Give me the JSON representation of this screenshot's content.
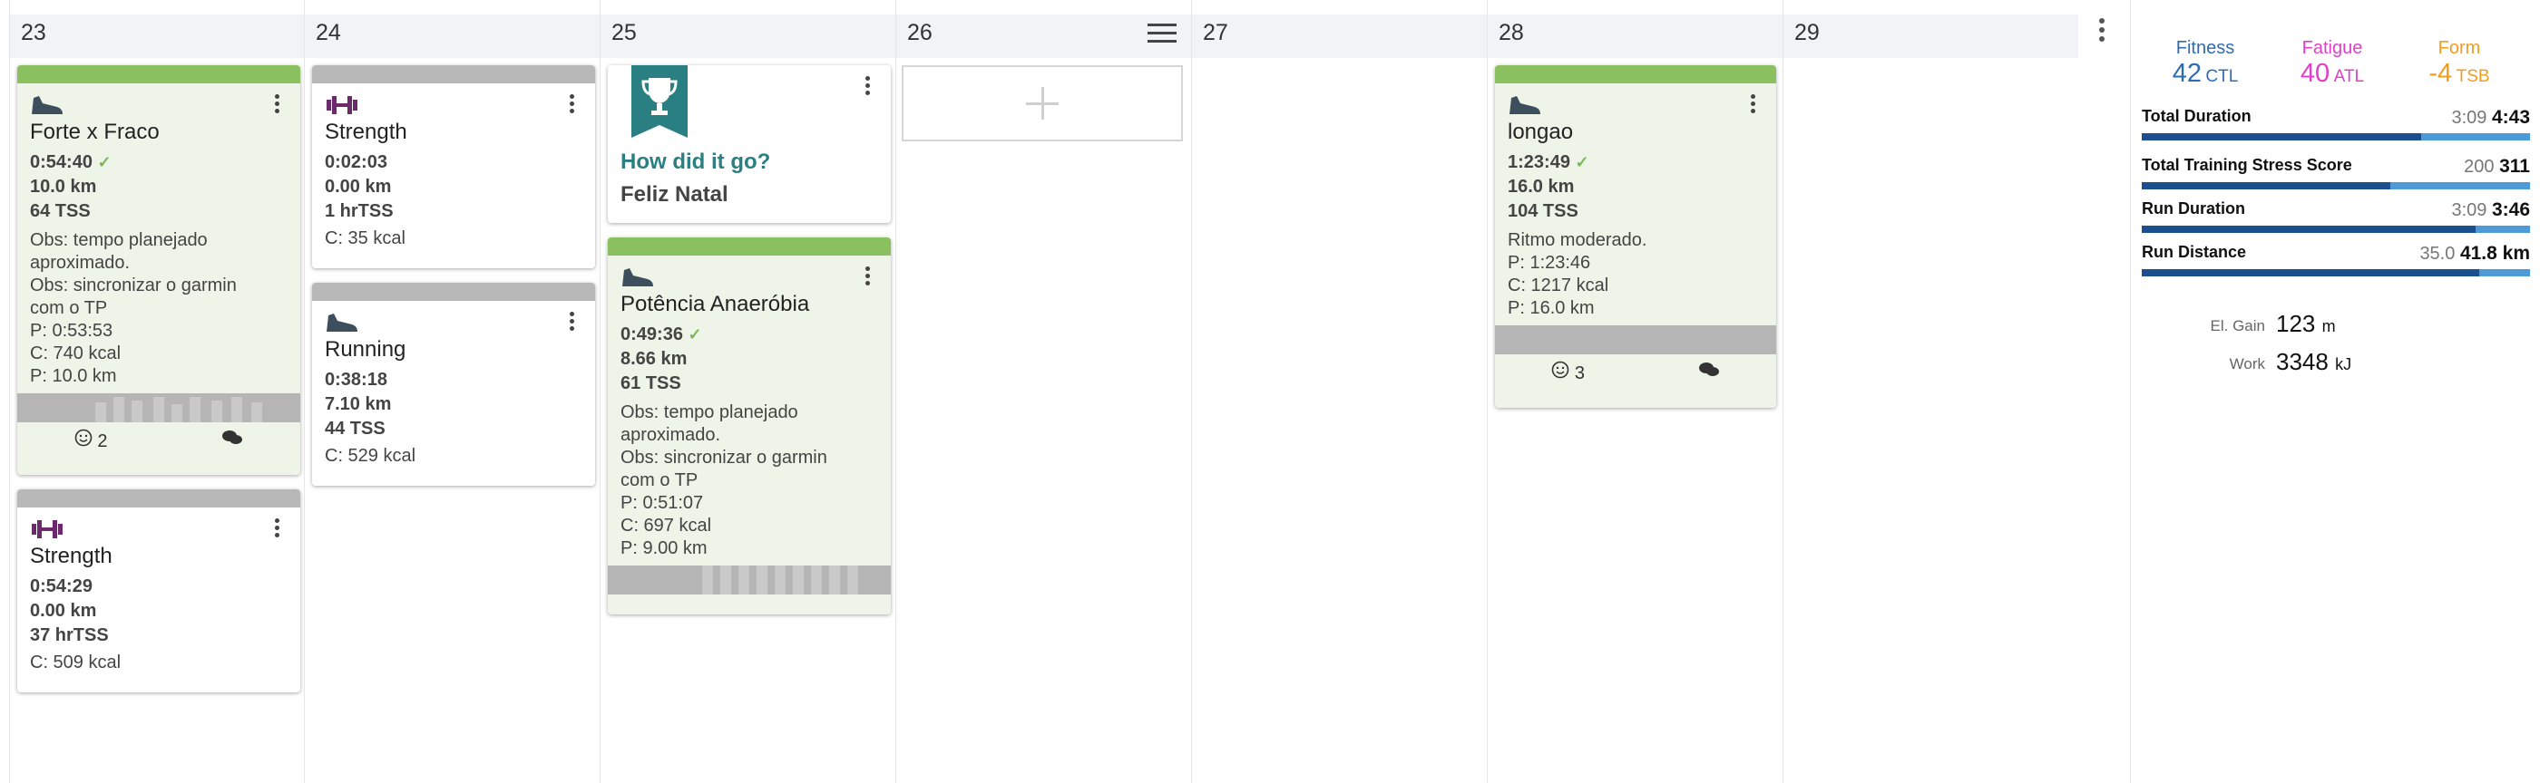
{
  "days": [
    "23",
    "24",
    "25",
    "26",
    "27",
    "28",
    "29"
  ],
  "cards": {
    "c23a": {
      "title": "Forte x Fraco",
      "duration": "0:54:40",
      "distance": "10.0 km",
      "tss": "64 TSS",
      "notes": [
        "Obs: tempo planejado",
        "aproximado.",
        "Obs: sincronizar o garmin",
        "com o TP",
        "P: 0:53:53",
        "C: 740 kcal",
        "P: 10.0 km"
      ],
      "mood": "2"
    },
    "c23b": {
      "title": "Strength",
      "duration": "0:54:29",
      "distance": "0.00 km",
      "tss": "37 hrTSS",
      "notes": [
        "C: 509 kcal"
      ]
    },
    "c24a": {
      "title": "Strength",
      "duration": "0:02:03",
      "distance": "0.00 km",
      "tss": "1 hrTSS",
      "notes": [
        "C: 35 kcal"
      ]
    },
    "c24b": {
      "title": "Running",
      "duration": "0:38:18",
      "distance": "7.10 km",
      "tss": "44 TSS",
      "notes": [
        "C: 529 kcal"
      ]
    },
    "c25a": {
      "question": "How did it go?",
      "title": "Feliz Natal"
    },
    "c25b": {
      "title": "Potência Anaeróbia",
      "duration": "0:49:36",
      "distance": "8.66 km",
      "tss": "61 TSS",
      "notes": [
        "Obs: tempo planejado",
        "aproximado.",
        "Obs: sincronizar o garmin",
        "com o TP",
        "P: 0:51:07",
        "C: 697 kcal",
        "P: 9.00 km"
      ]
    },
    "c28a": {
      "title": "longao",
      "duration": "1:23:49",
      "distance": "16.0 km",
      "tss": "104 TSS",
      "notes": [
        "Ritmo moderado.",
        "P: 1:23:46",
        "C: 1217 kcal",
        "P: 16.0 km"
      ],
      "mood": "3"
    }
  },
  "summary": {
    "fitness": {
      "label": "Fitness",
      "value": "42",
      "unit": "CTL",
      "color": "#2f6db3"
    },
    "fatigue": {
      "label": "Fatigue",
      "value": "40",
      "unit": "ATL",
      "color": "#e040c8"
    },
    "form": {
      "label": "Form",
      "value": "-4",
      "unit": "TSB",
      "color": "#f39c1e"
    },
    "bars": [
      {
        "label": "Total Duration",
        "planned": "3:09",
        "actual": "4:43",
        "fill": 0.72
      },
      {
        "label": "Total Training Stress Score",
        "planned": "200",
        "actual": "311",
        "fill": 0.64
      },
      {
        "label": "Run Duration",
        "planned": "3:09",
        "actual": "3:46",
        "fill": 0.86
      },
      {
        "label": "Run Distance",
        "planned": "35.0",
        "actual": "41.8 km",
        "fill": 0.87
      }
    ],
    "elgain": {
      "label": "El. Gain",
      "value": "123",
      "unit": "m"
    },
    "work": {
      "label": "Work",
      "value": "3348",
      "unit": "kJ"
    }
  }
}
